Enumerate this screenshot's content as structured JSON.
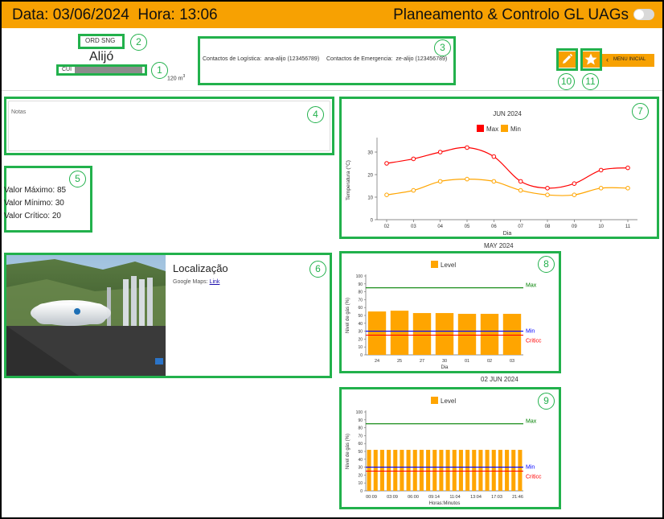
{
  "header": {
    "datetime": "Data: 03/06/2024  Hora: 13:06",
    "title": "Planeamento & Controlo GL UAGs"
  },
  "site": {
    "tag": "ORD SNG",
    "name": "Alijó",
    "cui_label": "CUI",
    "capacity_value": "120 m",
    "capacity_exp": "3"
  },
  "contacts": {
    "logistics": "Contactos de Logística:  ana-alijo (123456789)",
    "emergency": "Contactos de Emergencia:  ze-alijo (123456789)"
  },
  "toolbar": {
    "menu_label": "MENU INICIAL",
    "edit_icon": "pencil-icon",
    "fav_icon": "star-icon"
  },
  "notes": {
    "label": "Notas"
  },
  "values": {
    "max": "Valor Máximo: 85",
    "min": "Valor Mínimo: 30",
    "critical": "Valor Crítico: 20"
  },
  "location": {
    "title": "Localização",
    "maps_label": "Google Maps:",
    "maps_link": "Link"
  },
  "badges": [
    "1",
    "2",
    "3",
    "4",
    "5",
    "6",
    "7",
    "8",
    "9",
    "10",
    "11"
  ],
  "colors": {
    "accent": "#f7a102",
    "annotation": "#22b14c",
    "max": "#ff0000",
    "min": "#ffa500",
    "level": "#ffa500"
  },
  "chart_data": [
    {
      "type": "line",
      "title": "JUN 2024",
      "xlabel": "Dia",
      "ylabel": "Temperatura (°C)",
      "ylim": [
        0,
        35
      ],
      "yticks": [
        0,
        10,
        20,
        30
      ],
      "categories": [
        "02",
        "03",
        "04",
        "05",
        "06",
        "07",
        "08",
        "09",
        "10",
        "11"
      ],
      "series": [
        {
          "name": "Max",
          "color": "#ff0000",
          "values": [
            25,
            27,
            30,
            32,
            28,
            17,
            14,
            16,
            22,
            23
          ]
        },
        {
          "name": "Min",
          "color": "#ffa500",
          "values": [
            11,
            13,
            17,
            18,
            17,
            13,
            11,
            11,
            14,
            14
          ]
        }
      ],
      "legend": "top-center",
      "grid": false
    },
    {
      "type": "bar",
      "title": "MAY 2024",
      "xlabel": "Dia",
      "ylabel": "Nivel de gás (%)",
      "ylim": [
        0,
        100
      ],
      "yticks": [
        0,
        10,
        20,
        30,
        40,
        50,
        60,
        70,
        80,
        90,
        100
      ],
      "categories": [
        "24",
        "25",
        "27",
        "30",
        "01",
        "02",
        "03"
      ],
      "series": [
        {
          "name": "Level",
          "color": "#ffa500",
          "values": [
            55,
            56,
            53,
            53,
            52,
            52,
            52
          ]
        }
      ],
      "reference_lines": [
        {
          "label": "Max",
          "value": 85,
          "color": "#008000"
        },
        {
          "label": "Min",
          "value": 30,
          "color": "#0000ff"
        },
        {
          "label": "Criticc",
          "value": 25,
          "color": "#ff0000"
        }
      ],
      "legend": "top-center",
      "grid": false
    },
    {
      "type": "bar",
      "title": "02 JUN 2024",
      "xlabel": "Horas:Minutos",
      "ylabel": "Nivel de gás (%)",
      "ylim": [
        0,
        100
      ],
      "yticks": [
        0,
        10,
        20,
        30,
        40,
        50,
        60,
        70,
        80,
        90,
        100
      ],
      "tick_labels": [
        "00:09",
        "03:09",
        "06:00",
        "09:14",
        "11:04",
        "13:04",
        "17:03",
        "21:46"
      ],
      "series": [
        {
          "name": "Level",
          "color": "#ffa500",
          "values": [
            52,
            52,
            52,
            52,
            52,
            52,
            52,
            52,
            52,
            52,
            52,
            52,
            52,
            52,
            52,
            52,
            52,
            52,
            52,
            52,
            52,
            52,
            52,
            52
          ]
        }
      ],
      "reference_lines": [
        {
          "label": "Max",
          "value": 85,
          "color": "#008000"
        },
        {
          "label": "Min",
          "value": 30,
          "color": "#0000ff"
        },
        {
          "label": "Criticc",
          "value": 25,
          "color": "#ff0000"
        }
      ],
      "legend": "top-center",
      "grid": false
    }
  ]
}
